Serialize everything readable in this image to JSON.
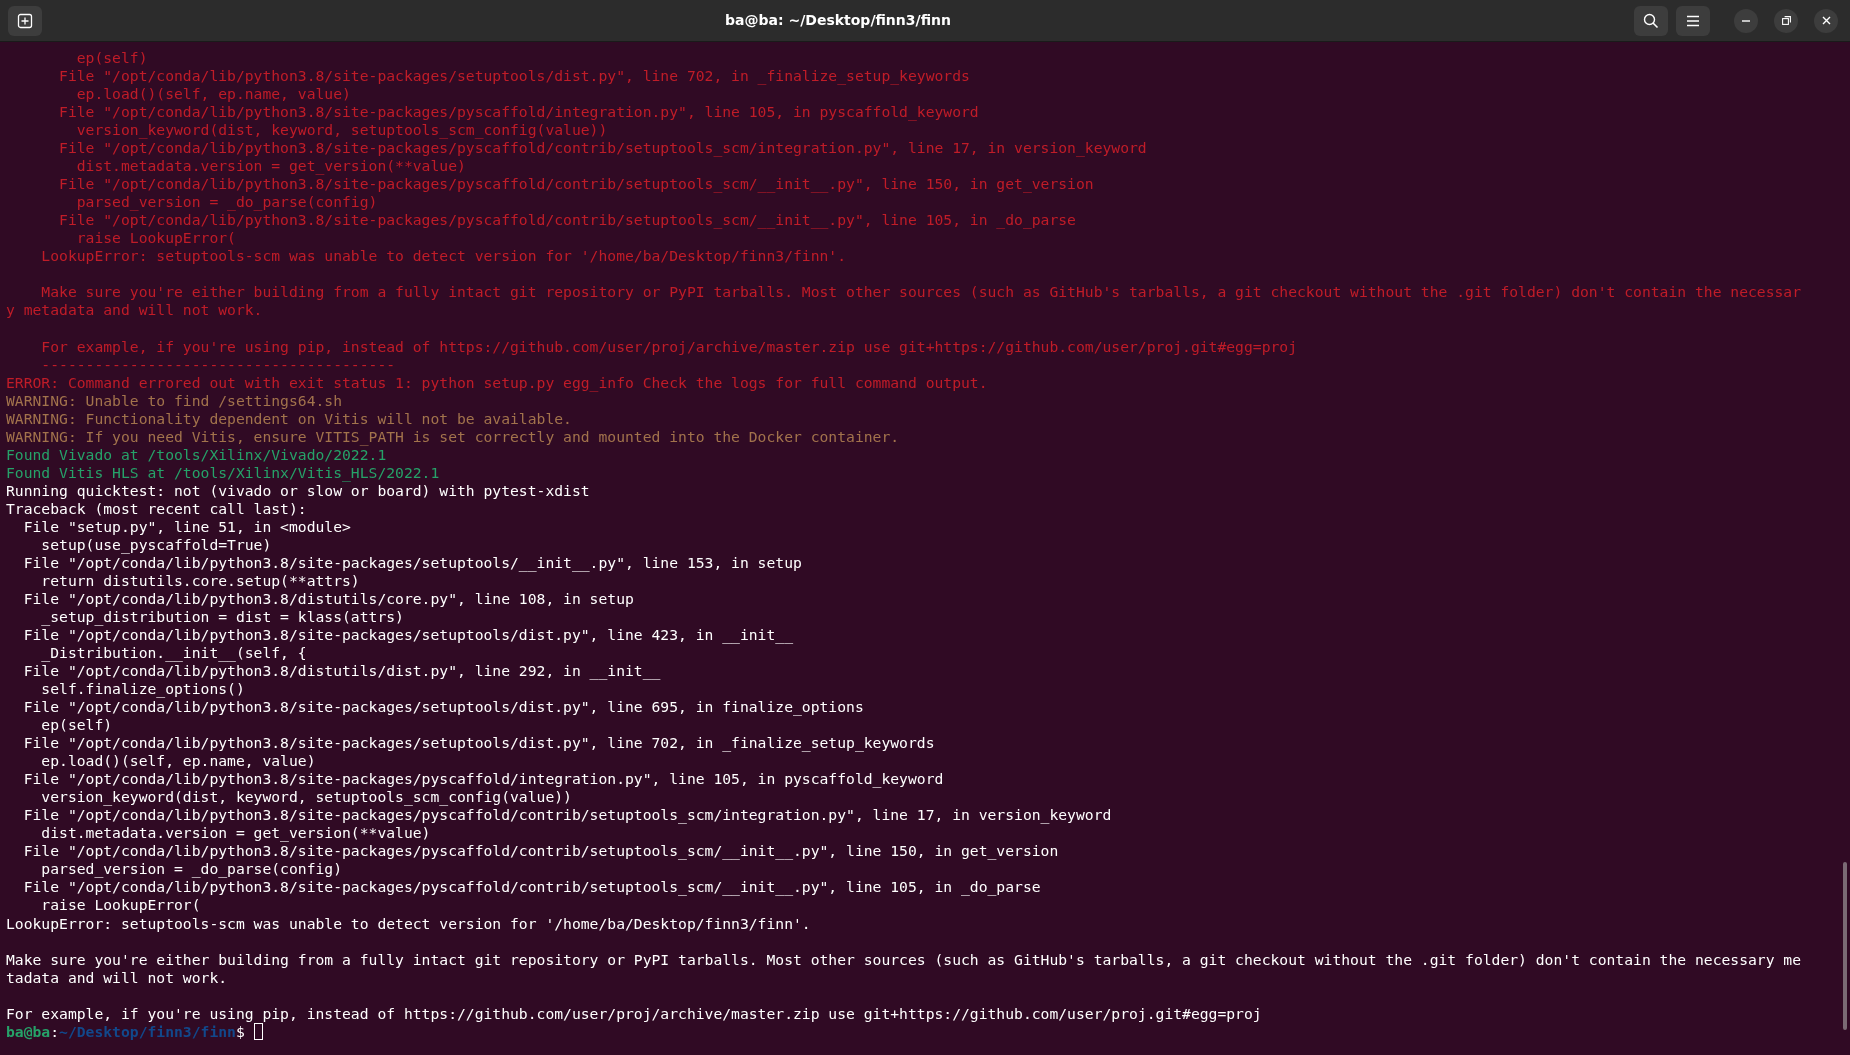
{
  "window": {
    "title": "ba@ba: ~/Desktop/finn3/finn"
  },
  "lines": [
    {
      "kind": "error",
      "text": "        ep(self)"
    },
    {
      "kind": "error",
      "text": "      File \"/opt/conda/lib/python3.8/site-packages/setuptools/dist.py\", line 702, in _finalize_setup_keywords"
    },
    {
      "kind": "error",
      "text": "        ep.load()(self, ep.name, value)"
    },
    {
      "kind": "error",
      "text": "      File \"/opt/conda/lib/python3.8/site-packages/pyscaffold/integration.py\", line 105, in pyscaffold_keyword"
    },
    {
      "kind": "error",
      "text": "        version_keyword(dist, keyword, setuptools_scm_config(value))"
    },
    {
      "kind": "error",
      "text": "      File \"/opt/conda/lib/python3.8/site-packages/pyscaffold/contrib/setuptools_scm/integration.py\", line 17, in version_keyword"
    },
    {
      "kind": "error",
      "text": "        dist.metadata.version = get_version(**value)"
    },
    {
      "kind": "error",
      "text": "      File \"/opt/conda/lib/python3.8/site-packages/pyscaffold/contrib/setuptools_scm/__init__.py\", line 150, in get_version"
    },
    {
      "kind": "error",
      "text": "        parsed_version = _do_parse(config)"
    },
    {
      "kind": "error",
      "text": "      File \"/opt/conda/lib/python3.8/site-packages/pyscaffold/contrib/setuptools_scm/__init__.py\", line 105, in _do_parse"
    },
    {
      "kind": "error",
      "text": "        raise LookupError("
    },
    {
      "kind": "error",
      "text": "    LookupError: setuptools-scm was unable to detect version for '/home/ba/Desktop/finn3/finn'."
    },
    {
      "kind": "blank"
    },
    {
      "kind": "error",
      "text": "    Make sure you're either building from a fully intact git repository or PyPI tarballs. Most other sources (such as GitHub's tarballs, a git checkout without the .git folder) don't contain the necessar"
    },
    {
      "kind": "error",
      "text": "y metadata and will not work."
    },
    {
      "kind": "blank"
    },
    {
      "kind": "error",
      "text": "    For example, if you're using pip, instead of https://github.com/user/proj/archive/master.zip use git+https://github.com/user/proj.git#egg=proj"
    },
    {
      "kind": "error",
      "text": "    ----------------------------------------"
    },
    {
      "kind": "error",
      "text": "ERROR: Command errored out with exit status 1: python setup.py egg_info Check the logs for full command output."
    },
    {
      "kind": "warning",
      "text": "WARNING: Unable to find /settings64.sh"
    },
    {
      "kind": "warning",
      "text": "WARNING: Functionality dependent on Vitis will not be available."
    },
    {
      "kind": "warning",
      "text": "WARNING: If you need Vitis, ensure VITIS_PATH is set correctly and mounted into the Docker container."
    },
    {
      "kind": "success",
      "text": "Found Vivado at /tools/Xilinx/Vivado/2022.1"
    },
    {
      "kind": "success",
      "text": "Found Vitis HLS at /tools/Xilinx/Vitis_HLS/2022.1"
    },
    {
      "kind": "output",
      "text": "Running quicktest: not (vivado or slow or board) with pytest-xdist"
    },
    {
      "kind": "output",
      "text": "Traceback (most recent call last):"
    },
    {
      "kind": "output",
      "text": "  File \"setup.py\", line 51, in <module>"
    },
    {
      "kind": "output",
      "text": "    setup(use_pyscaffold=True)"
    },
    {
      "kind": "output",
      "text": "  File \"/opt/conda/lib/python3.8/site-packages/setuptools/__init__.py\", line 153, in setup"
    },
    {
      "kind": "output",
      "text": "    return distutils.core.setup(**attrs)"
    },
    {
      "kind": "output",
      "text": "  File \"/opt/conda/lib/python3.8/distutils/core.py\", line 108, in setup"
    },
    {
      "kind": "output",
      "text": "    _setup_distribution = dist = klass(attrs)"
    },
    {
      "kind": "output",
      "text": "  File \"/opt/conda/lib/python3.8/site-packages/setuptools/dist.py\", line 423, in __init__"
    },
    {
      "kind": "output",
      "text": "    _Distribution.__init__(self, {"
    },
    {
      "kind": "output",
      "text": "  File \"/opt/conda/lib/python3.8/distutils/dist.py\", line 292, in __init__"
    },
    {
      "kind": "output",
      "text": "    self.finalize_options()"
    },
    {
      "kind": "output",
      "text": "  File \"/opt/conda/lib/python3.8/site-packages/setuptools/dist.py\", line 695, in finalize_options"
    },
    {
      "kind": "output",
      "text": "    ep(self)"
    },
    {
      "kind": "output",
      "text": "  File \"/opt/conda/lib/python3.8/site-packages/setuptools/dist.py\", line 702, in _finalize_setup_keywords"
    },
    {
      "kind": "output",
      "text": "    ep.load()(self, ep.name, value)"
    },
    {
      "kind": "output",
      "text": "  File \"/opt/conda/lib/python3.8/site-packages/pyscaffold/integration.py\", line 105, in pyscaffold_keyword"
    },
    {
      "kind": "output",
      "text": "    version_keyword(dist, keyword, setuptools_scm_config(value))"
    },
    {
      "kind": "output",
      "text": "  File \"/opt/conda/lib/python3.8/site-packages/pyscaffold/contrib/setuptools_scm/integration.py\", line 17, in version_keyword"
    },
    {
      "kind": "output",
      "text": "    dist.metadata.version = get_version(**value)"
    },
    {
      "kind": "output",
      "text": "  File \"/opt/conda/lib/python3.8/site-packages/pyscaffold/contrib/setuptools_scm/__init__.py\", line 150, in get_version"
    },
    {
      "kind": "output",
      "text": "    parsed_version = _do_parse(config)"
    },
    {
      "kind": "output",
      "text": "  File \"/opt/conda/lib/python3.8/site-packages/pyscaffold/contrib/setuptools_scm/__init__.py\", line 105, in _do_parse"
    },
    {
      "kind": "output",
      "text": "    raise LookupError("
    },
    {
      "kind": "output",
      "text": "LookupError: setuptools-scm was unable to detect version for '/home/ba/Desktop/finn3/finn'."
    },
    {
      "kind": "blank"
    },
    {
      "kind": "output",
      "text": "Make sure you're either building from a fully intact git repository or PyPI tarballs. Most other sources (such as GitHub's tarballs, a git checkout without the .git folder) don't contain the necessary me"
    },
    {
      "kind": "output",
      "text": "tadata and will not work."
    },
    {
      "kind": "blank"
    },
    {
      "kind": "output",
      "text": "For example, if you're using pip, instead of https://github.com/user/proj/archive/master.zip use git+https://github.com/user/proj.git#egg=proj"
    }
  ],
  "prompt": {
    "user_host": "ba@ba",
    "separator": ":",
    "path": "~/Desktop/finn3/finn",
    "symbol": "$"
  }
}
